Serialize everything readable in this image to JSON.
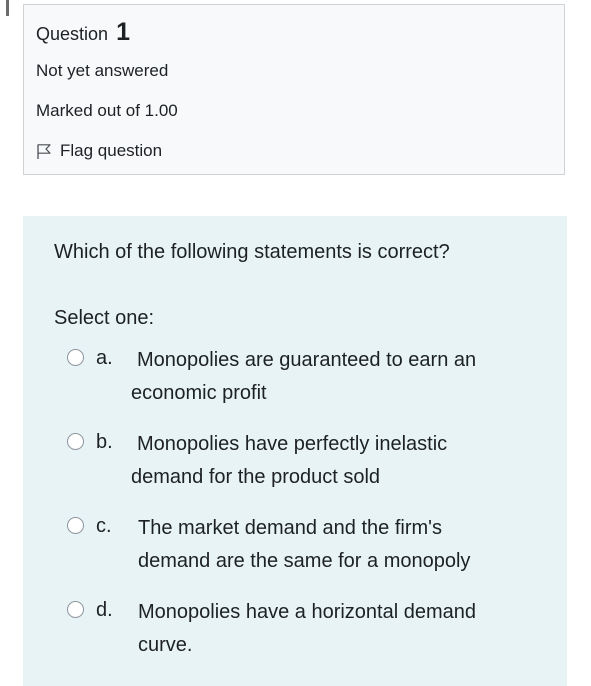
{
  "question": {
    "title_prefix": "Question",
    "number": "1",
    "status": "Not yet answered",
    "marks": "Marked out of 1.00",
    "flag_label": "Flag question"
  },
  "content": {
    "question_text": "Which of the following statements is correct?",
    "prompt": "Select one:",
    "options": [
      {
        "letter": "a.",
        "line1": "Monopolies are guaranteed to earn an",
        "line2": "economic profit",
        "selected": false
      },
      {
        "letter": "b.",
        "line1": "Monopolies have perfectly inelastic",
        "line2": "demand for the product sold",
        "selected": false
      },
      {
        "letter": "c.",
        "line1": "The market demand and the firm's",
        "line2": "demand are the same for a monopoly",
        "selected": false
      },
      {
        "letter": "d.",
        "line1": "Monopolies have a horizontal demand",
        "line2": "curve.",
        "selected": false
      }
    ]
  },
  "colors": {
    "info_background": "#f8f9fa",
    "info_border": "#cfd3d6",
    "content_background": "#e7f3f5",
    "text": "#1d2125",
    "radio_border": "#8f959e"
  },
  "icons": {
    "flag": "flag-outline-icon",
    "radio": "radio-unchecked-icon"
  }
}
